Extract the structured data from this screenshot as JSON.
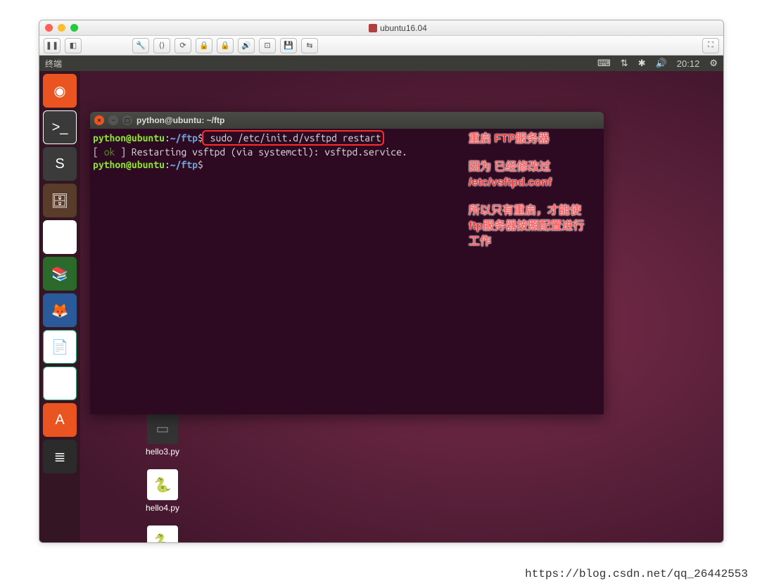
{
  "host_title": "ubuntu16.04",
  "toolbar": {
    "pause": "❚❚",
    "snapshot": "◧",
    "wrench": "🔧",
    "network": "⟨⟩",
    "disk": "⟳",
    "lock1": "🔒",
    "lock2": "🔒",
    "sound": "🔊",
    "usb": "⊡",
    "floppy": "💾",
    "share": "⇆",
    "fullscreen": "⛶"
  },
  "menubar": {
    "app": "终端",
    "net": "⇅",
    "bt": "✱",
    "vol": "🔊",
    "time": "20:12",
    "gear": "⚙"
  },
  "launcher": {
    "ubuntu": "◉",
    "terminal": ">_",
    "sublime": "S",
    "files": "🗄",
    "chrome": "◯",
    "books": "📚",
    "firefox": "🦊",
    "writer": "📄",
    "calc": "▦",
    "software": "A",
    "trash": "≣"
  },
  "term": {
    "title": "python@ubuntu: ~/ftp",
    "prompt": {
      "user": "python",
      "at": "@",
      "host": "ubuntu",
      "colon": ":",
      "path": "~/ftp",
      "dollar": "$"
    },
    "cmd1": " sudo /etc/init.d/vsftpd restart",
    "out1_pre": "[ ",
    "out1_ok": "ok",
    "out1_post": " ] Restarting vsftpd (via systemctl): vsftpd.service.",
    "cmd2": " "
  },
  "desktop": {
    "file1": "hello3.py",
    "file2": "hello4.py",
    "file3": ""
  },
  "annot": {
    "l1": "重启 FTP服务器",
    "l2": "因为 已经修改过 /etc/vsftpd.conf",
    "l3": "所以只有重启，才能使ftp服务器按照配置进行工作"
  },
  "watermark": "https://blog.csdn.net/qq_26442553"
}
